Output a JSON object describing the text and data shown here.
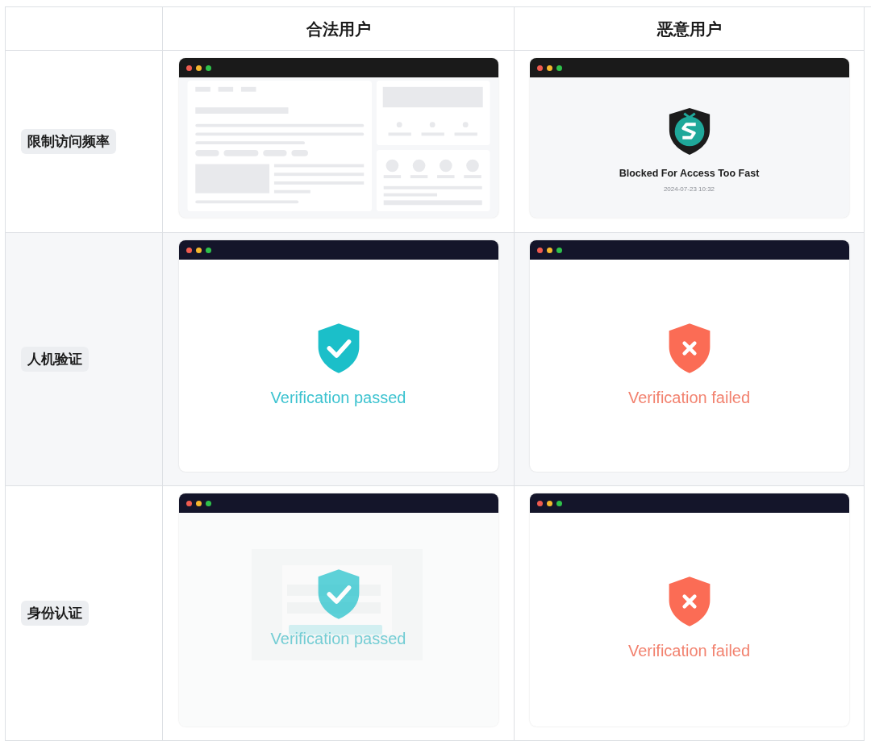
{
  "table": {
    "columns": [
      {
        "label": "合法用户"
      },
      {
        "label": "恶意用户"
      }
    ],
    "rows": [
      {
        "label": "限制访问频率",
        "cells": [
          {
            "kind": "skeleton"
          },
          {
            "kind": "blocked",
            "title": "Blocked For Access Too Fast",
            "timestamp": "2024-07-23 10:32"
          }
        ]
      },
      {
        "label": "人机验证",
        "cells": [
          {
            "kind": "passed",
            "message": "Verification passed"
          },
          {
            "kind": "failed",
            "message": "Verification failed"
          }
        ]
      },
      {
        "label": "身份认证",
        "cells": [
          {
            "kind": "login_passed",
            "message": "Verification passed"
          },
          {
            "kind": "failed",
            "message": "Verification failed"
          }
        ]
      }
    ]
  }
}
